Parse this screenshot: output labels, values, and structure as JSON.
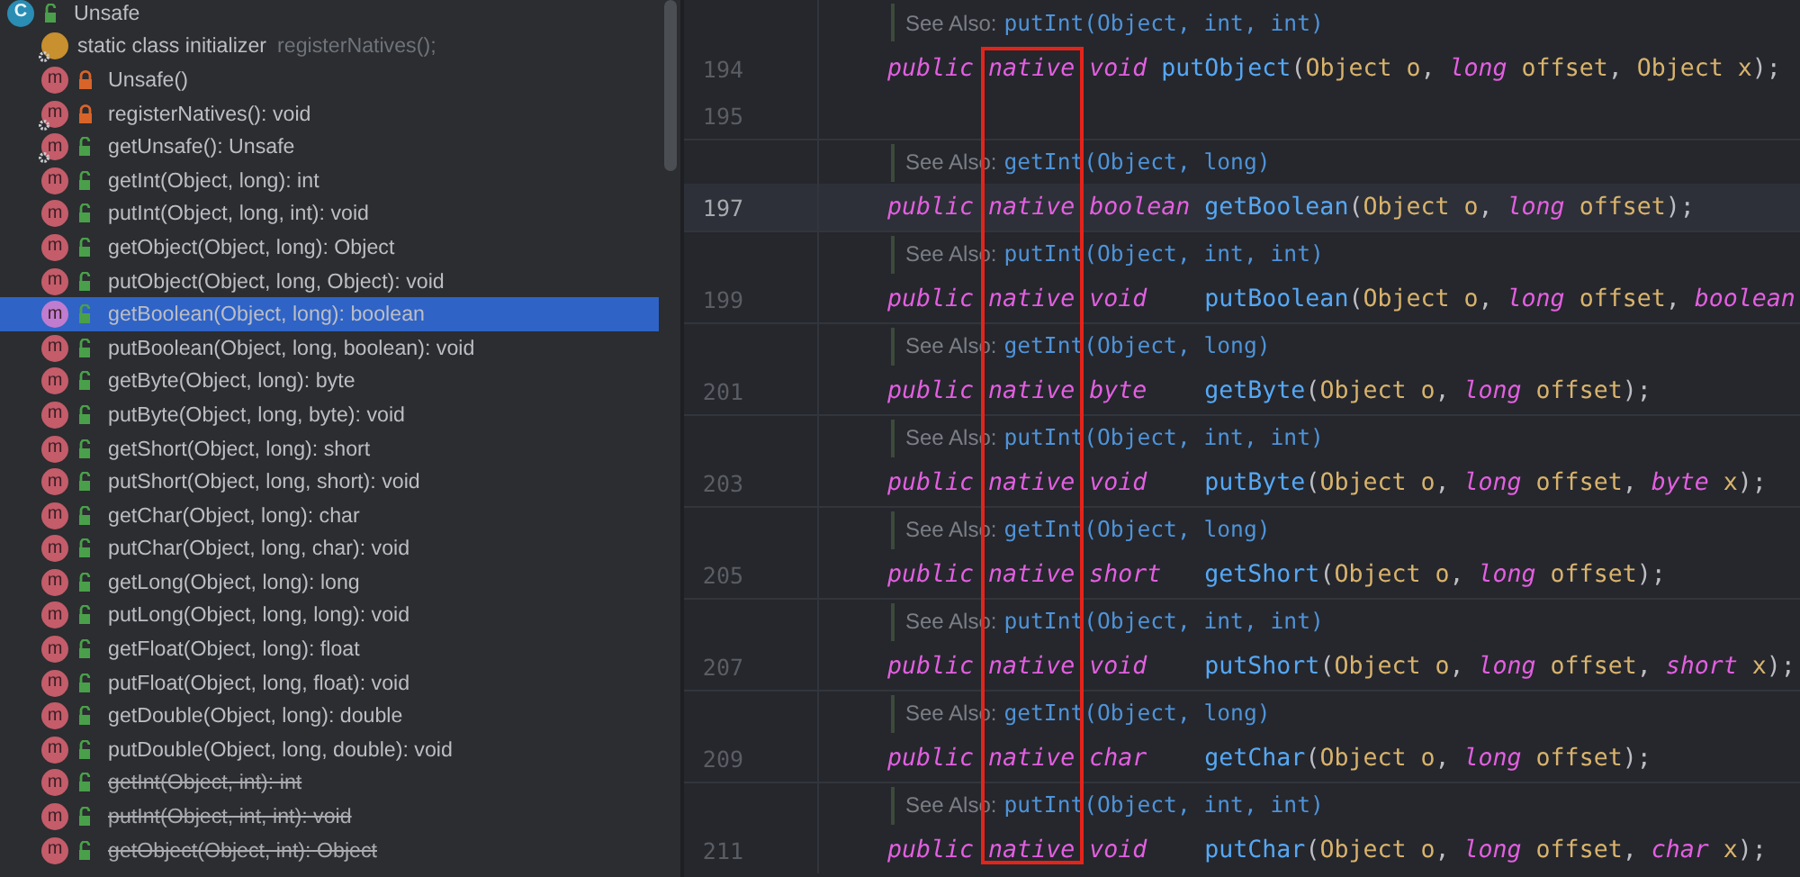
{
  "structure": {
    "items": [
      {
        "kind": "class",
        "badge": "C",
        "label": "Unsafe",
        "locked": false,
        "static": false,
        "deprecated": false,
        "selected": false,
        "children": [
          {
            "kind": "initializer",
            "label": "static class initializer",
            "hint": "registerNatives();",
            "static": true,
            "deprecated": false,
            "selected": false
          },
          {
            "kind": "method",
            "badge": "m",
            "label": "Unsafe()",
            "locked": true,
            "static": false,
            "deprecated": false,
            "selected": false
          },
          {
            "kind": "method",
            "badge": "m",
            "label": "registerNatives(): void",
            "locked": true,
            "static": true,
            "deprecated": false,
            "selected": false
          },
          {
            "kind": "method",
            "badge": "m",
            "label": "getUnsafe(): Unsafe",
            "locked": false,
            "static": true,
            "deprecated": false,
            "selected": false
          },
          {
            "kind": "method",
            "badge": "m",
            "label": "getInt(Object, long): int",
            "locked": false,
            "static": false,
            "deprecated": false,
            "selected": false
          },
          {
            "kind": "method",
            "badge": "m",
            "label": "putInt(Object, long, int): void",
            "locked": false,
            "static": false,
            "deprecated": false,
            "selected": false
          },
          {
            "kind": "method",
            "badge": "m",
            "label": "getObject(Object, long): Object",
            "locked": false,
            "static": false,
            "deprecated": false,
            "selected": false
          },
          {
            "kind": "method",
            "badge": "m",
            "label": "putObject(Object, long, Object): void",
            "locked": false,
            "static": false,
            "deprecated": false,
            "selected": false
          },
          {
            "kind": "method",
            "badge": "m",
            "label": "getBoolean(Object, long): boolean",
            "locked": false,
            "static": false,
            "deprecated": false,
            "selected": true
          },
          {
            "kind": "method",
            "badge": "m",
            "label": "putBoolean(Object, long, boolean): void",
            "locked": false,
            "static": false,
            "deprecated": false,
            "selected": false
          },
          {
            "kind": "method",
            "badge": "m",
            "label": "getByte(Object, long): byte",
            "locked": false,
            "static": false,
            "deprecated": false,
            "selected": false
          },
          {
            "kind": "method",
            "badge": "m",
            "label": "putByte(Object, long, byte): void",
            "locked": false,
            "static": false,
            "deprecated": false,
            "selected": false
          },
          {
            "kind": "method",
            "badge": "m",
            "label": "getShort(Object, long): short",
            "locked": false,
            "static": false,
            "deprecated": false,
            "selected": false
          },
          {
            "kind": "method",
            "badge": "m",
            "label": "putShort(Object, long, short): void",
            "locked": false,
            "static": false,
            "deprecated": false,
            "selected": false
          },
          {
            "kind": "method",
            "badge": "m",
            "label": "getChar(Object, long): char",
            "locked": false,
            "static": false,
            "deprecated": false,
            "selected": false
          },
          {
            "kind": "method",
            "badge": "m",
            "label": "putChar(Object, long, char): void",
            "locked": false,
            "static": false,
            "deprecated": false,
            "selected": false
          },
          {
            "kind": "method",
            "badge": "m",
            "label": "getLong(Object, long): long",
            "locked": false,
            "static": false,
            "deprecated": false,
            "selected": false
          },
          {
            "kind": "method",
            "badge": "m",
            "label": "putLong(Object, long, long): void",
            "locked": false,
            "static": false,
            "deprecated": false,
            "selected": false
          },
          {
            "kind": "method",
            "badge": "m",
            "label": "getFloat(Object, long): float",
            "locked": false,
            "static": false,
            "deprecated": false,
            "selected": false
          },
          {
            "kind": "method",
            "badge": "m",
            "label": "putFloat(Object, long, float): void",
            "locked": false,
            "static": false,
            "deprecated": false,
            "selected": false
          },
          {
            "kind": "method",
            "badge": "m",
            "label": "getDouble(Object, long): double",
            "locked": false,
            "static": false,
            "deprecated": false,
            "selected": false
          },
          {
            "kind": "method",
            "badge": "m",
            "label": "putDouble(Object, long, double): void",
            "locked": false,
            "static": false,
            "deprecated": false,
            "selected": false
          },
          {
            "kind": "method",
            "badge": "m",
            "label": "getInt(Object, int): int",
            "locked": false,
            "static": false,
            "deprecated": true,
            "selected": false
          },
          {
            "kind": "method",
            "badge": "m",
            "label": "putInt(Object, int, int): void",
            "locked": false,
            "static": false,
            "deprecated": true,
            "selected": false
          },
          {
            "kind": "method",
            "badge": "m",
            "label": "getObject(Object, int): Object",
            "locked": false,
            "static": false,
            "deprecated": true,
            "selected": false
          }
        ]
      }
    ]
  },
  "editor": {
    "lines": [
      {
        "kind": "doc",
        "label": "See Also:",
        "link": "putInt(Object, int, int)"
      },
      {
        "kind": "code",
        "number": "194",
        "current": false,
        "tokens": [
          {
            "text": "public ",
            "kind": "keyword"
          },
          {
            "text": "native ",
            "kind": "keyword"
          },
          {
            "text": "void ",
            "kind": "keyword"
          },
          {
            "text": "putObject",
            "kind": "method"
          },
          {
            "text": "(",
            "kind": "plain"
          },
          {
            "text": "Object o",
            "kind": "param"
          },
          {
            "text": ", ",
            "kind": "plain"
          },
          {
            "text": "long ",
            "kind": "keyword"
          },
          {
            "text": "offset",
            "kind": "param"
          },
          {
            "text": ", ",
            "kind": "plain"
          },
          {
            "text": "Object x",
            "kind": "param"
          },
          {
            "text": ");",
            "kind": "plain"
          }
        ]
      },
      {
        "kind": "code",
        "number": "195",
        "current": false
      },
      {
        "kind": "doc",
        "label": "See Also:",
        "link": "getInt(Object, long)"
      },
      {
        "kind": "code",
        "number": "197",
        "current": true,
        "tokens": [
          {
            "text": "public ",
            "kind": "keyword"
          },
          {
            "text": "native ",
            "kind": "keyword"
          },
          {
            "text": "boolean ",
            "kind": "keyword"
          },
          {
            "text": "getBoolean",
            "kind": "method"
          },
          {
            "text": "(",
            "kind": "plain"
          },
          {
            "text": "Object o",
            "kind": "param"
          },
          {
            "text": ", ",
            "kind": "plain"
          },
          {
            "text": "long ",
            "kind": "keyword"
          },
          {
            "text": "offset",
            "kind": "param"
          },
          {
            "text": ");",
            "kind": "plain"
          }
        ]
      },
      {
        "kind": "doc",
        "label": "See Also:",
        "link": "putInt(Object, int, int)"
      },
      {
        "kind": "code",
        "number": "199",
        "current": false,
        "tokens": [
          {
            "text": "public ",
            "kind": "keyword"
          },
          {
            "text": "native ",
            "kind": "keyword"
          },
          {
            "text": "void    ",
            "kind": "keyword"
          },
          {
            "text": "putBoolean",
            "kind": "method"
          },
          {
            "text": "(",
            "kind": "plain"
          },
          {
            "text": "Object o",
            "kind": "param"
          },
          {
            "text": ", ",
            "kind": "plain"
          },
          {
            "text": "long ",
            "kind": "keyword"
          },
          {
            "text": "offset",
            "kind": "param"
          },
          {
            "text": ", ",
            "kind": "plain"
          },
          {
            "text": "boolean",
            "kind": "keyword"
          }
        ]
      },
      {
        "kind": "doc",
        "label": "See Also:",
        "link": "getInt(Object, long)"
      },
      {
        "kind": "code",
        "number": "201",
        "current": false,
        "tokens": [
          {
            "text": "public ",
            "kind": "keyword"
          },
          {
            "text": "native ",
            "kind": "keyword"
          },
          {
            "text": "byte    ",
            "kind": "keyword"
          },
          {
            "text": "getByte",
            "kind": "method"
          },
          {
            "text": "(",
            "kind": "plain"
          },
          {
            "text": "Object o",
            "kind": "param"
          },
          {
            "text": ", ",
            "kind": "plain"
          },
          {
            "text": "long ",
            "kind": "keyword"
          },
          {
            "text": "offset",
            "kind": "param"
          },
          {
            "text": ");",
            "kind": "plain"
          }
        ]
      },
      {
        "kind": "doc",
        "label": "See Also:",
        "link": "putInt(Object, int, int)"
      },
      {
        "kind": "code",
        "number": "203",
        "current": false,
        "tokens": [
          {
            "text": "public ",
            "kind": "keyword"
          },
          {
            "text": "native ",
            "kind": "keyword"
          },
          {
            "text": "void    ",
            "kind": "keyword"
          },
          {
            "text": "putByte",
            "kind": "method"
          },
          {
            "text": "(",
            "kind": "plain"
          },
          {
            "text": "Object o",
            "kind": "param"
          },
          {
            "text": ", ",
            "kind": "plain"
          },
          {
            "text": "long ",
            "kind": "keyword"
          },
          {
            "text": "offset",
            "kind": "param"
          },
          {
            "text": ", ",
            "kind": "plain"
          },
          {
            "text": "byte ",
            "kind": "keyword"
          },
          {
            "text": "x",
            "kind": "param"
          },
          {
            "text": ");",
            "kind": "plain"
          }
        ]
      },
      {
        "kind": "doc",
        "label": "See Also:",
        "link": "getInt(Object, long)"
      },
      {
        "kind": "code",
        "number": "205",
        "current": false,
        "tokens": [
          {
            "text": "public ",
            "kind": "keyword"
          },
          {
            "text": "native ",
            "kind": "keyword"
          },
          {
            "text": "short   ",
            "kind": "keyword"
          },
          {
            "text": "getShort",
            "kind": "method"
          },
          {
            "text": "(",
            "kind": "plain"
          },
          {
            "text": "Object o",
            "kind": "param"
          },
          {
            "text": ", ",
            "kind": "plain"
          },
          {
            "text": "long ",
            "kind": "keyword"
          },
          {
            "text": "offset",
            "kind": "param"
          },
          {
            "text": ");",
            "kind": "plain"
          }
        ]
      },
      {
        "kind": "doc",
        "label": "See Also:",
        "link": "putInt(Object, int, int)"
      },
      {
        "kind": "code",
        "number": "207",
        "current": false,
        "tokens": [
          {
            "text": "public ",
            "kind": "keyword"
          },
          {
            "text": "native ",
            "kind": "keyword"
          },
          {
            "text": "void    ",
            "kind": "keyword"
          },
          {
            "text": "putShort",
            "kind": "method"
          },
          {
            "text": "(",
            "kind": "plain"
          },
          {
            "text": "Object o",
            "kind": "param"
          },
          {
            "text": ", ",
            "kind": "plain"
          },
          {
            "text": "long ",
            "kind": "keyword"
          },
          {
            "text": "offset",
            "kind": "param"
          },
          {
            "text": ", ",
            "kind": "plain"
          },
          {
            "text": "short ",
            "kind": "keyword"
          },
          {
            "text": "x",
            "kind": "param"
          },
          {
            "text": ");",
            "kind": "plain"
          }
        ]
      },
      {
        "kind": "doc",
        "label": "See Also:",
        "link": "getInt(Object, long)"
      },
      {
        "kind": "code",
        "number": "209",
        "current": false,
        "tokens": [
          {
            "text": "public ",
            "kind": "keyword"
          },
          {
            "text": "native ",
            "kind": "keyword"
          },
          {
            "text": "char    ",
            "kind": "keyword"
          },
          {
            "text": "getChar",
            "kind": "method"
          },
          {
            "text": "(",
            "kind": "plain"
          },
          {
            "text": "Object o",
            "kind": "param"
          },
          {
            "text": ", ",
            "kind": "plain"
          },
          {
            "text": "long ",
            "kind": "keyword"
          },
          {
            "text": "offset",
            "kind": "param"
          },
          {
            "text": ");",
            "kind": "plain"
          }
        ]
      },
      {
        "kind": "doc",
        "label": "See Also:",
        "link": "putInt(Object, int, int)"
      },
      {
        "kind": "code",
        "number": "211",
        "current": false,
        "tokens": [
          {
            "text": "public ",
            "kind": "keyword"
          },
          {
            "text": "native ",
            "kind": "keyword"
          },
          {
            "text": "void    ",
            "kind": "keyword"
          },
          {
            "text": "putChar",
            "kind": "method"
          },
          {
            "text": "(",
            "kind": "plain"
          },
          {
            "text": "Object o",
            "kind": "param"
          },
          {
            "text": ", ",
            "kind": "plain"
          },
          {
            "text": "long ",
            "kind": "keyword"
          },
          {
            "text": "offset",
            "kind": "param"
          },
          {
            "text": ", ",
            "kind": "plain"
          },
          {
            "text": "char ",
            "kind": "keyword"
          },
          {
            "text": "x",
            "kind": "param"
          },
          {
            "text": ");",
            "kind": "plain"
          }
        ]
      }
    ]
  }
}
